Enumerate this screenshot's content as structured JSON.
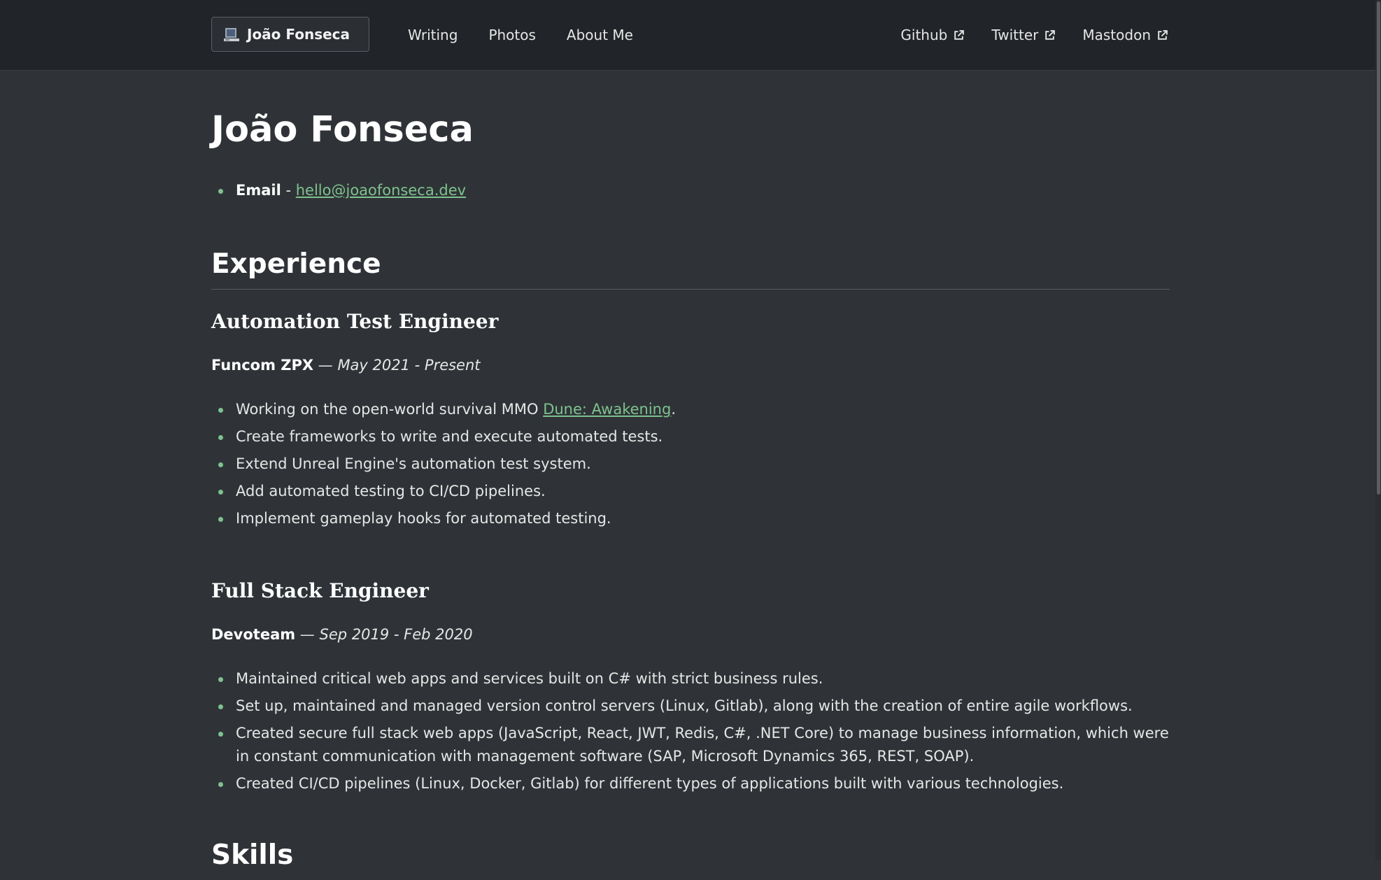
{
  "nav": {
    "brand": {
      "name": "João Fonseca",
      "icon": "computer-icon"
    },
    "left_links": [
      {
        "label": "Writing"
      },
      {
        "label": "Photos"
      },
      {
        "label": "About Me"
      }
    ],
    "right_links": [
      {
        "label": "Github",
        "icon": "external-link-icon"
      },
      {
        "label": "Twitter",
        "icon": "external-link-icon"
      },
      {
        "label": "Mastodon",
        "icon": "external-link-icon"
      }
    ]
  },
  "page": {
    "title": "João Fonseca",
    "contact": {
      "label": "Email",
      "separator": " - ",
      "email": "hello@joaofonseca.dev"
    }
  },
  "experience": {
    "heading": "Experience",
    "jobs": [
      {
        "title": "Automation Test Engineer",
        "company": "Funcom ZPX",
        "dash": " — ",
        "period": "May 2021 - Present",
        "bullets": [
          {
            "pre": "Working on the open-world survival MMO ",
            "link": "Dune: Awakening",
            "post": "."
          },
          {
            "pre": "Create frameworks to write and execute automated tests."
          },
          {
            "pre": "Extend Unreal Engine's automation test system."
          },
          {
            "pre": "Add automated testing to CI/CD pipelines."
          },
          {
            "pre": "Implement gameplay hooks for automated testing."
          }
        ]
      },
      {
        "title": "Full Stack Engineer",
        "company": "Devoteam",
        "dash": " — ",
        "period": "Sep 2019 - Feb 2020",
        "bullets": [
          {
            "pre": "Maintained critical web apps and services built on C# with strict business rules."
          },
          {
            "pre": "Set up, maintained and managed version control servers (Linux, Gitlab), along with the creation of entire agile workflows."
          },
          {
            "pre": "Created secure full stack web apps (JavaScript, React, JWT, Redis, C#, .NET Core) to manage business information, which were in constant communication with management software (SAP, Microsoft Dynamics 365, REST, SOAP)."
          },
          {
            "pre": "Created CI/CD pipelines (Linux, Docker, Gitlab) for different types of applications built with various technologies."
          }
        ]
      }
    ]
  },
  "skills": {
    "heading": "Skills"
  },
  "colors": {
    "background": "#2f3337",
    "navbar": "#212428",
    "accent": "#7ec28e"
  }
}
